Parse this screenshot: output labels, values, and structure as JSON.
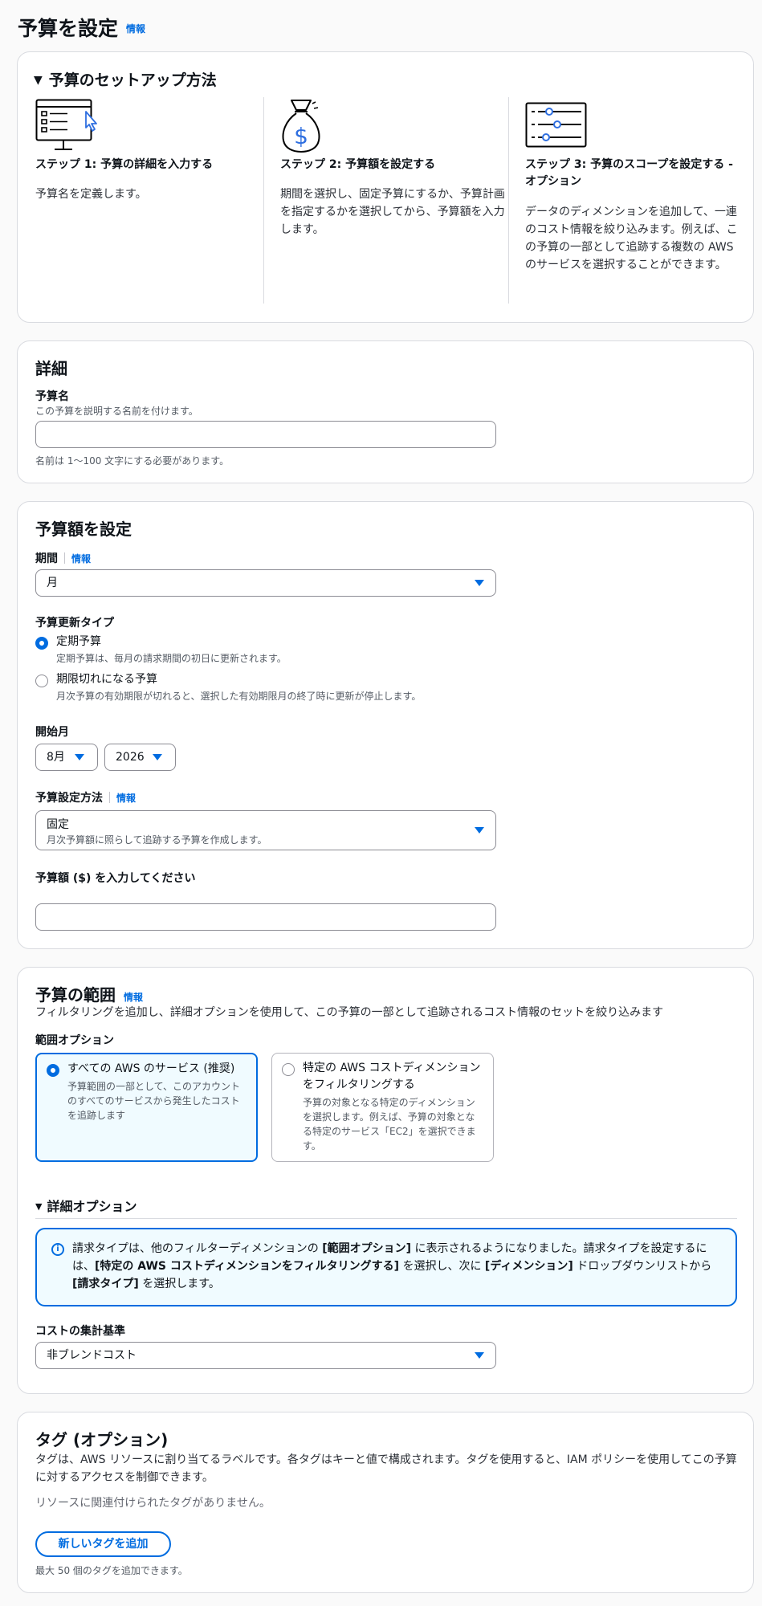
{
  "page": {
    "title": "予算を設定",
    "info": "情報"
  },
  "setup": {
    "heading": "予算のセットアップ方法",
    "steps": [
      {
        "title": "ステップ 1: 予算の詳細を入力する",
        "desc": "予算名を定義します。",
        "icon": "computer-screen-icon"
      },
      {
        "title": "ステップ 2: 予算額を設定する",
        "desc": "期間を選択し、固定予算にするか、予算計画を指定するかを選択してから、予算額を入力します。",
        "icon": "money-bag-icon"
      },
      {
        "title": "ステップ 3: 予算のスコープを設定する - オプション",
        "desc": "データのディメンションを追加して、一連のコスト情報を絞り込みます。例えば、この予算の一部として追跡する複数の AWS のサービスを選択することができます。",
        "icon": "sliders-icon"
      }
    ]
  },
  "details": {
    "heading": "詳細",
    "name_label": "予算名",
    "name_desc": "この予算を説明する名前を付けます。",
    "name_value": "",
    "name_constraint": "名前は 1～100 文字にする必要があります。"
  },
  "amount": {
    "heading": "予算額を設定",
    "period_label": "期間",
    "period_info": "情報",
    "period_value": "月",
    "renewal_label": "予算更新タイプ",
    "renewal_options": [
      {
        "label": "定期予算",
        "desc": "定期予算は、毎月の請求期間の初日に更新されます。",
        "checked": true
      },
      {
        "label": "期限切れになる予算",
        "desc": "月次予算の有効期限が切れると、選択した有効期限月の終了時に更新が停止します。",
        "checked": false
      }
    ],
    "start_label": "開始月",
    "start_month": "8月",
    "start_year": "2026",
    "method_label": "予算設定方法",
    "method_info": "情報",
    "method_value": "固定",
    "method_desc": "月次予算額に照らして追跡する予算を作成します。",
    "amount_label": "予算額 ($) を入力してください",
    "amount_value": ""
  },
  "scope": {
    "heading": "予算の範囲",
    "info": "情報",
    "desc": "フィルタリングを追加し、詳細オプションを使用して、この予算の一部として追跡されるコスト情報のセットを絞り込みます",
    "options_label": "範囲オプション",
    "tiles": [
      {
        "title": "すべての AWS のサービス (推奨)",
        "desc": "予算範囲の一部として、このアカウントのすべてのサービスから発生したコストを追跡します",
        "selected": true
      },
      {
        "title": "特定の AWS コストディメンションをフィルタリングする",
        "desc": "予算の対象となる特定のディメンションを選択します。例えば、予算の対象となる特定のサービス「EC2」を選択できます。",
        "selected": false
      }
    ],
    "advanced_label": "詳細オプション",
    "alert_parts": {
      "a": "請求タイプは、他のフィルターディメンションの ",
      "b": "[範囲オプション]",
      "c": " に表示されるようになりました。請求タイプを設定するには、",
      "d": "[特定の AWS コストディメンションをフィルタリングする]",
      "e": " を選択し、次に ",
      "f": "[ディメンション]",
      "g": " ドロップダウンリストから ",
      "h": "[請求タイプ]",
      "i": " を選択します。"
    },
    "aggregation_label": "コストの集計基準",
    "aggregation_value": "非ブレンドコスト"
  },
  "tags": {
    "heading": "タグ (オプション)",
    "desc": "タグは、AWS リソースに割り当てるラベルです。各タグはキーと値で構成されます。タグを使用すると、IAM ポリシーを使用してこの予算に対するアクセスを制御できます。",
    "empty": "リソースに関連付けられたタグがありません。",
    "add_button": "新しいタグを追加",
    "limit": "最大 50 個のタグを追加できます。"
  },
  "colors": {
    "accent": "#006ce0",
    "border": "#d9dbe0",
    "selected_bg": "#f0fbff"
  }
}
